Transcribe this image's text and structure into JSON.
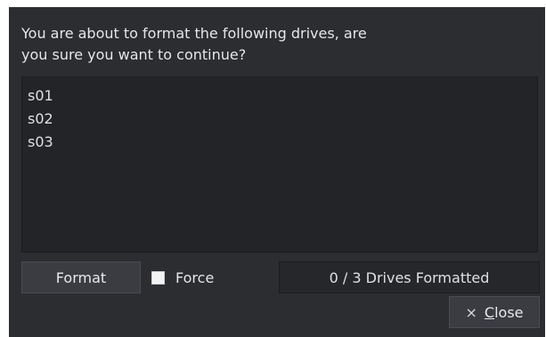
{
  "dialog": {
    "message": "You are about to format the following drives, are\nyou sure you want to continue?",
    "drives": [
      "s01",
      "s02",
      "s03"
    ],
    "format_label": "Format",
    "force_label": "Force",
    "force_checked": false,
    "status_text": "0 / 3 Drives Formatted",
    "close_icon": "×",
    "close_label_mnemonic": "C",
    "close_label_rest": "lose"
  },
  "colors": {
    "background": "#2b2d31",
    "list_background": "#232428",
    "button_background": "#3a3c42",
    "text": "#e6e6e6"
  }
}
